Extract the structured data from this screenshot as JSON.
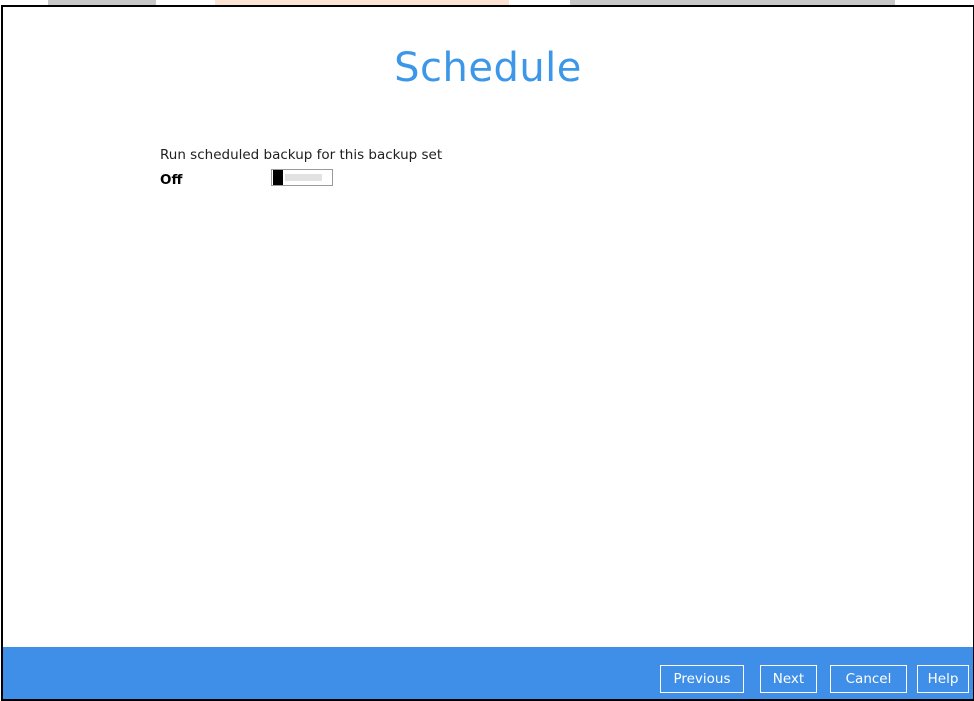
{
  "page": {
    "title": "Schedule"
  },
  "schedule": {
    "field_label": "Run scheduled backup for this backup set",
    "state_label": "Off",
    "toggle_on": false
  },
  "footer": {
    "buttons": {
      "previous": "Previous",
      "next": "Next",
      "cancel": "Cancel",
      "help": "Help"
    }
  },
  "colors": {
    "title": "#3d97e8",
    "footer_bg": "#3f8fe8",
    "toggle_knob": "#000000"
  }
}
